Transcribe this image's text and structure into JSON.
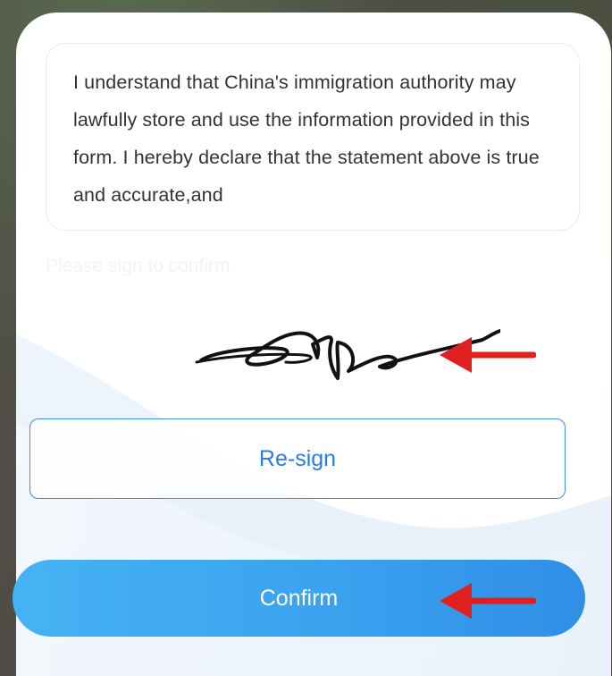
{
  "statement": {
    "text": "I understand that China's immigration authority may lawfully store and use the information provided in this form. I hereby declare that the statement above is true and accurate,and"
  },
  "signature_area": {
    "hint": "Please sign to confirm"
  },
  "buttons": {
    "resign_label": "Re-sign",
    "confirm_label": "Confirm"
  },
  "colors": {
    "accent_blue": "#3ba2ef",
    "outline_blue": "#3f8ef0",
    "annotation_red": "#e02020"
  },
  "icons": {
    "annotation_arrow": "red-left-arrow-icon"
  }
}
